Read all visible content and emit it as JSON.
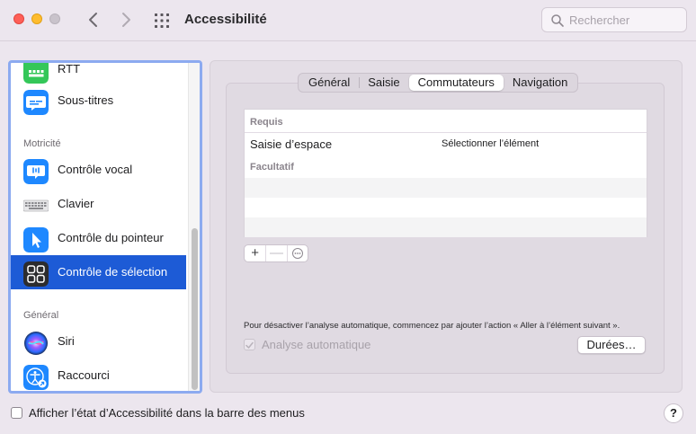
{
  "window": {
    "title": "Accessibilité",
    "search_placeholder": "Rechercher"
  },
  "sidebar": {
    "items": [
      {
        "label": "RTT",
        "icon": "rtt-keyboard-icon"
      },
      {
        "label": "Sous-titres",
        "icon": "subtitles-icon"
      },
      {
        "label": "Contrôle vocal",
        "icon": "voice-control-icon"
      },
      {
        "label": "Clavier",
        "icon": "keyboard-icon"
      },
      {
        "label": "Contrôle du pointeur",
        "icon": "pointer-icon"
      },
      {
        "label": "Contrôle de sélection",
        "icon": "switch-control-icon",
        "selected": true
      },
      {
        "label": "Siri",
        "icon": "siri-icon"
      },
      {
        "label": "Raccourci",
        "icon": "accessibility-shortcut-icon"
      }
    ],
    "sections": {
      "motricite": "Motricité",
      "general": "Général"
    }
  },
  "tabs": [
    {
      "label": "Général"
    },
    {
      "label": "Saisie"
    },
    {
      "label": "Commutateurs",
      "active": true
    },
    {
      "label": "Navigation"
    }
  ],
  "table": {
    "header_required": "Requis",
    "row": {
      "switch": "Saisie d’espace",
      "action": "Sélectionner l’élément"
    },
    "header_optional": "Facultatif"
  },
  "buttons": {
    "add": "+",
    "remove": "—",
    "more": "⋯"
  },
  "hint": "Pour désactiver l’analyse automatique, commencez par ajouter l’action « Aller à l’élément suivant ».",
  "auto_scan": {
    "label": "Analyse automatique",
    "checked": true,
    "enabled": false
  },
  "durations_button": "Durées…",
  "footer": {
    "menu_bar_label": "Afficher l’état d’Accessibilité dans la barre des menus",
    "checked": false,
    "help": "?"
  },
  "colors": {
    "selection": "#1d5bd6",
    "focus_ring": "#8caaf0",
    "background": "#ece6ee"
  }
}
